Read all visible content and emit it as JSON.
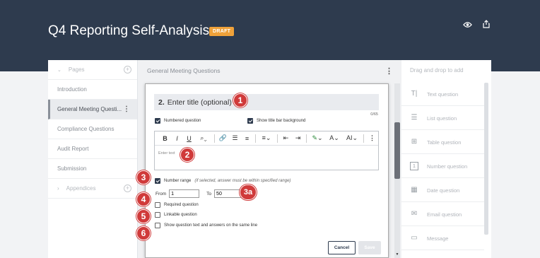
{
  "header": {
    "title": "Q4 Reporting Self-Analysis",
    "badge": "DRAFT",
    "icons": [
      "eye-icon",
      "share-icon"
    ]
  },
  "left_panel": {
    "pages_label": "Pages",
    "items": [
      "Introduction",
      "General Meeting Questi...",
      "Compliance Questions",
      "Audit Report",
      "Submission"
    ],
    "appendices_label": "Appendices"
  },
  "main": {
    "section_title": "General Meeting Questions",
    "question": {
      "number": "2.",
      "title_placeholder": "Enter title (optional)",
      "char_count": "0/65",
      "numbered_question": "Numbered question",
      "show_title_bar": "Show title bar background",
      "editor_placeholder": "Enter text",
      "number_range": "Number range",
      "number_range_hint": "(if selected, answer must be within specified range)",
      "from_label": "From",
      "from_value": "1",
      "to_label": "To",
      "to_value": "50",
      "required": "Required question",
      "linkable": "Linkable question",
      "same_line": "Show question text and answers on the same line",
      "cancel": "Cancel",
      "save": "Save"
    },
    "toolbar": {
      "bold": "B",
      "italic": "I",
      "underline": "U",
      "font_size": "A",
      "text_style": "AI"
    }
  },
  "right_panel": {
    "header": "Drag and drop to add",
    "items": [
      "Text question",
      "List question",
      "Table question",
      "Number question",
      "Date question",
      "Email question",
      "Message"
    ]
  },
  "annotations": [
    "1",
    "2",
    "3",
    "3a",
    "4",
    "5",
    "6"
  ],
  "colors": {
    "header_bg": "#2e3b4e",
    "draft_badge": "#f0a23a",
    "annotation": "#d03a3a"
  }
}
